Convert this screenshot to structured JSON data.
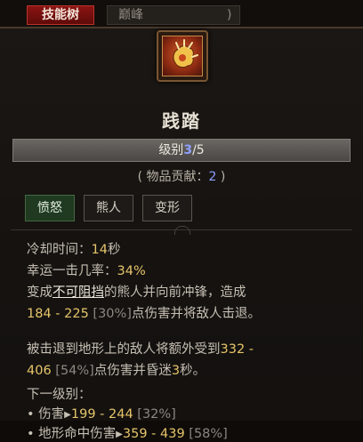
{
  "tabs": {
    "active": "技能树",
    "inactive": "巅峰",
    "inactive_suffix": ")"
  },
  "skill": {
    "icon": "bear-paw-icon",
    "title": "践踏",
    "rank_label": "级别",
    "rank_current": "3",
    "rank_max": "/5",
    "contrib_prefix": "( 物品贡献：",
    "contrib_value": "2",
    "contrib_suffix": " )",
    "tags": [
      "愤怒",
      "熊人",
      "变形"
    ]
  },
  "stats": {
    "cooldown_label": "冷却时间：",
    "cooldown_value": "14",
    "cooldown_unit": "秒",
    "lucky_label": "幸运一击几率：",
    "lucky_value": "34%"
  },
  "desc": {
    "l1a": "变成",
    "l1u": "不可阻挡",
    "l1b": "的熊人并向前冲锋，造成",
    "l2v": "184 - 225",
    "l2p": " [30%]",
    "l2t": "点伤害并将敌人击退。",
    "l3t": "被击退到地形上的敌人将额外受到",
    "l3v": "332 -",
    "l4v": "406",
    "l4p": " [54%]",
    "l4t": "点伤害并昏迷",
    "l4s": "3",
    "l4e": "秒。"
  },
  "next": {
    "label": "下一级别：",
    "items": [
      {
        "name": "伤害",
        "value": "199 - 244",
        "pct": " [32%]"
      },
      {
        "name": "地形命中伤害",
        "value": "359 - 439",
        "pct": " [58%]"
      }
    ]
  }
}
